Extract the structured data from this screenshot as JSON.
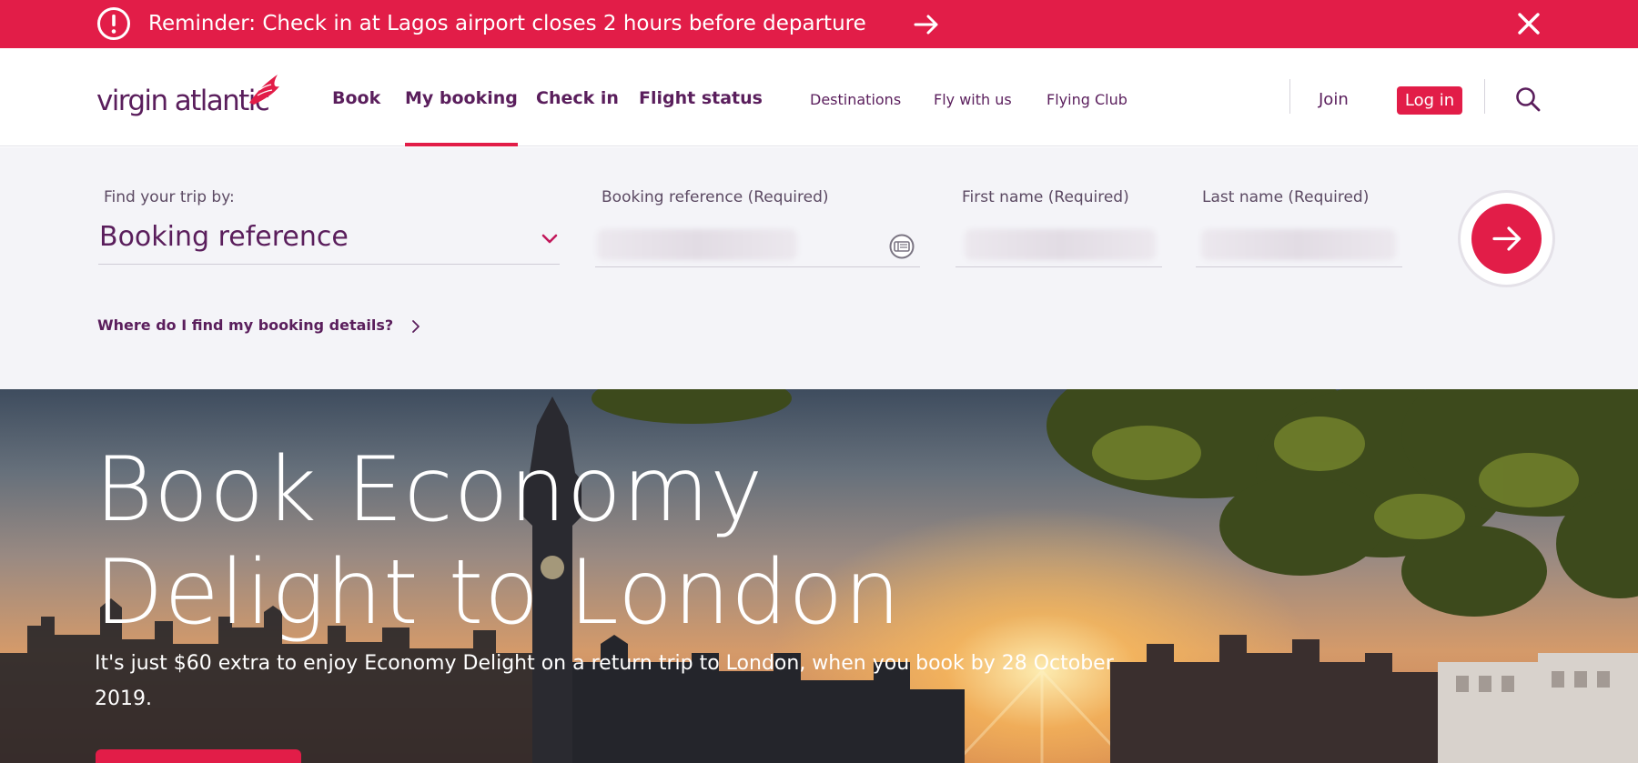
{
  "alert": {
    "text": "Reminder: Check in at Lagos airport closes 2 hours before departure",
    "icon": "exclamation-circle-icon",
    "color": "#e21d48"
  },
  "header": {
    "logo_text": "virgin atlantic",
    "nav": [
      "Book",
      "My booking",
      "Check in",
      "Flight status"
    ],
    "active_nav": "My booking",
    "secondary_nav": [
      "Destinations",
      "Fly with us",
      "Flying Club"
    ],
    "join_label": "Join",
    "login_label": "Log in"
  },
  "booking": {
    "find_label": "Find your trip by:",
    "selected_option": "Booking reference",
    "fields": {
      "booking_reference": {
        "label": "Booking reference (Required)",
        "value": ""
      },
      "first_name": {
        "label": "First name (Required)",
        "value": ""
      },
      "last_name": {
        "label": "Last name (Required)",
        "value": ""
      }
    },
    "help_link": "Where do I find my booking details?"
  },
  "hero": {
    "title": "Book Economy Delight to London",
    "subtitle": "It's just $60 extra to enjoy Economy Delight on a return trip to London, when you book by 28 October 2019."
  },
  "colors": {
    "brand_red": "#e21d48",
    "brand_purple": "#5a1e5c",
    "panel_bg": "#f4f4f8"
  }
}
